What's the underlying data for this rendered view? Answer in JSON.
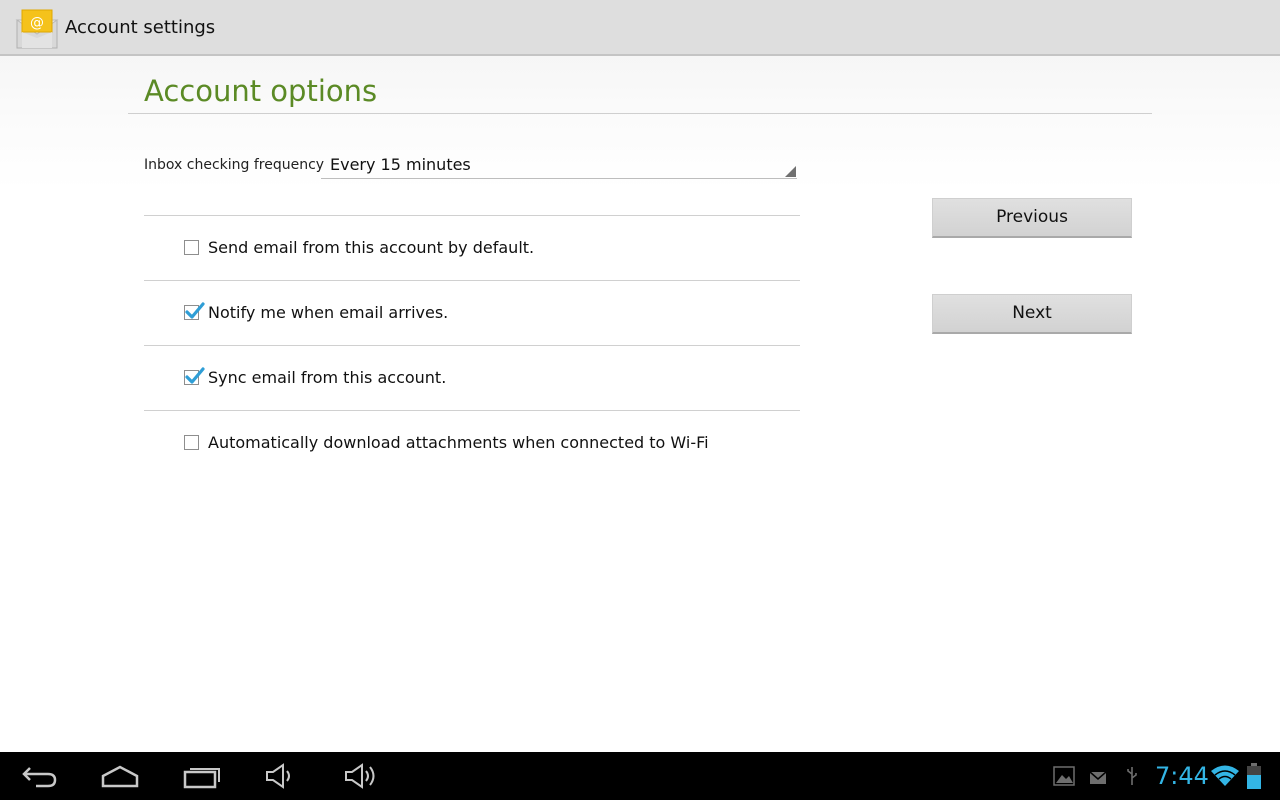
{
  "app_bar": {
    "title": "Account settings",
    "icon": "email-app-icon"
  },
  "section": {
    "title": "Account options"
  },
  "frequency": {
    "label": "Inbox checking frequency",
    "selected": "Every 15 minutes"
  },
  "options": [
    {
      "label": "Send email from this account by default.",
      "checked": false
    },
    {
      "label": "Notify me when email arrives.",
      "checked": true
    },
    {
      "label": "Sync email from this account.",
      "checked": true
    },
    {
      "label": "Automatically download attachments when connected to Wi-Fi",
      "checked": false
    }
  ],
  "buttons": {
    "previous": "Previous",
    "next": "Next"
  },
  "status_bar": {
    "time": "7:44",
    "icons": [
      "gallery-icon",
      "email-notification-icon",
      "usb-icon",
      "wifi-icon",
      "battery-icon"
    ]
  },
  "nav_bar": {
    "icons": [
      "back-icon",
      "home-icon",
      "recent-apps-icon",
      "volume-down-icon",
      "volume-up-icon"
    ]
  },
  "colors": {
    "accent_green": "#5b8a25",
    "holo_blue": "#33b5e5",
    "checkmark": "#2f9ed6"
  }
}
